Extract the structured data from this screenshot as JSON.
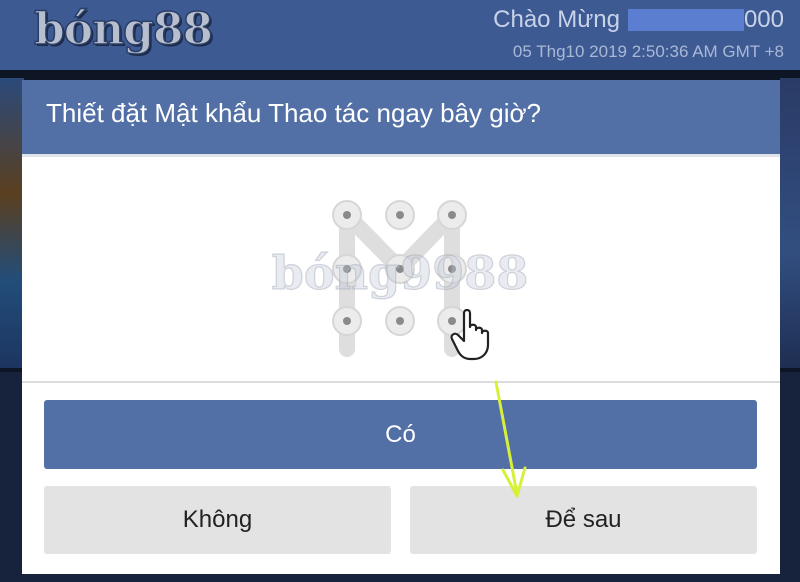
{
  "header": {
    "logo_text": "bóng88",
    "greeting": "Chào Mừng",
    "greeting_suffix": "000",
    "datetime": "05 Thg10 2019 2:50:36 AM GMT +8"
  },
  "modal": {
    "title": "Thiết đặt Mật khẩu Thao tác ngay bây giờ?",
    "watermark": "bóng9988",
    "buttons": {
      "yes": "Có",
      "no": "Không",
      "later": "Để sau"
    }
  },
  "colors": {
    "header_bg": "#3d5a93",
    "modal_header_bg": "#5270a6",
    "primary_button": "#5270a6",
    "secondary_button": "#e3e3e3",
    "annotation_arrow": "#d7f03a"
  },
  "icons": {
    "pattern": "pattern-lock-icon",
    "hand": "hand-pointer-icon",
    "annotation": "arrow-annotation-icon"
  }
}
